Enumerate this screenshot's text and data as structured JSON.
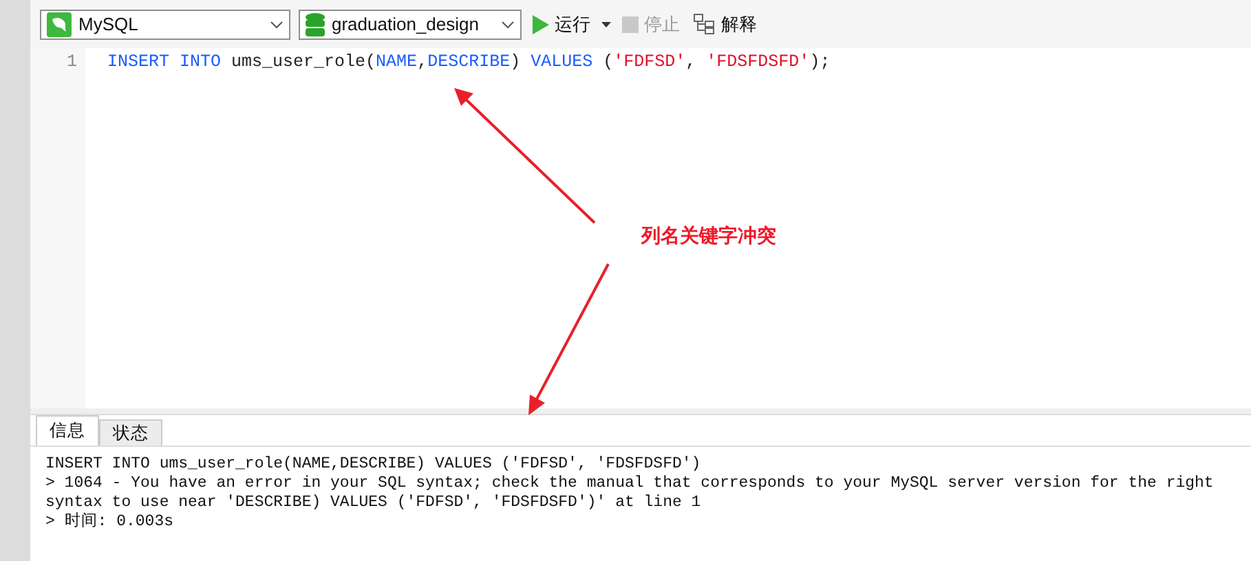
{
  "toolbar": {
    "connection": "MySQL",
    "database": "graduation_design",
    "run": "运行",
    "stop": {
      "label": "停止",
      "disabled": true
    },
    "explain": "解释"
  },
  "editor": {
    "lines": [
      {
        "number": "1",
        "tokens": [
          {
            "kind": "keyword",
            "text": "INSERT INTO"
          },
          {
            "kind": "plain",
            "text": " ums_user_role("
          },
          {
            "kind": "keyword",
            "text": "NAME"
          },
          {
            "kind": "plain",
            "text": ","
          },
          {
            "kind": "keyword",
            "text": "DESCRIBE"
          },
          {
            "kind": "plain",
            "text": ") "
          },
          {
            "kind": "keyword",
            "text": "VALUES"
          },
          {
            "kind": "plain",
            "text": " ("
          },
          {
            "kind": "string",
            "text": "'FDFSD'"
          },
          {
            "kind": "plain",
            "text": ", "
          },
          {
            "kind": "string",
            "text": "'FDSFDSFD'"
          },
          {
            "kind": "plain",
            "text": ");"
          }
        ]
      }
    ]
  },
  "annotation": {
    "text": "列名关键字冲突"
  },
  "result_tabs": [
    {
      "label": "信息",
      "selected": true
    },
    {
      "label": "状态",
      "selected": false
    }
  ],
  "messages": [
    "INSERT INTO ums_user_role(NAME,DESCRIBE) VALUES ('FDFSD', 'FDSFDSFD')",
    "> 1064 - You have an error in your SQL syntax; check the manual that corresponds to your MySQL server version for the right syntax to use near 'DESCRIBE) VALUES ('FDFSD', 'FDSFDSFD')' at line 1",
    "> 时间: 0.003s"
  ]
}
